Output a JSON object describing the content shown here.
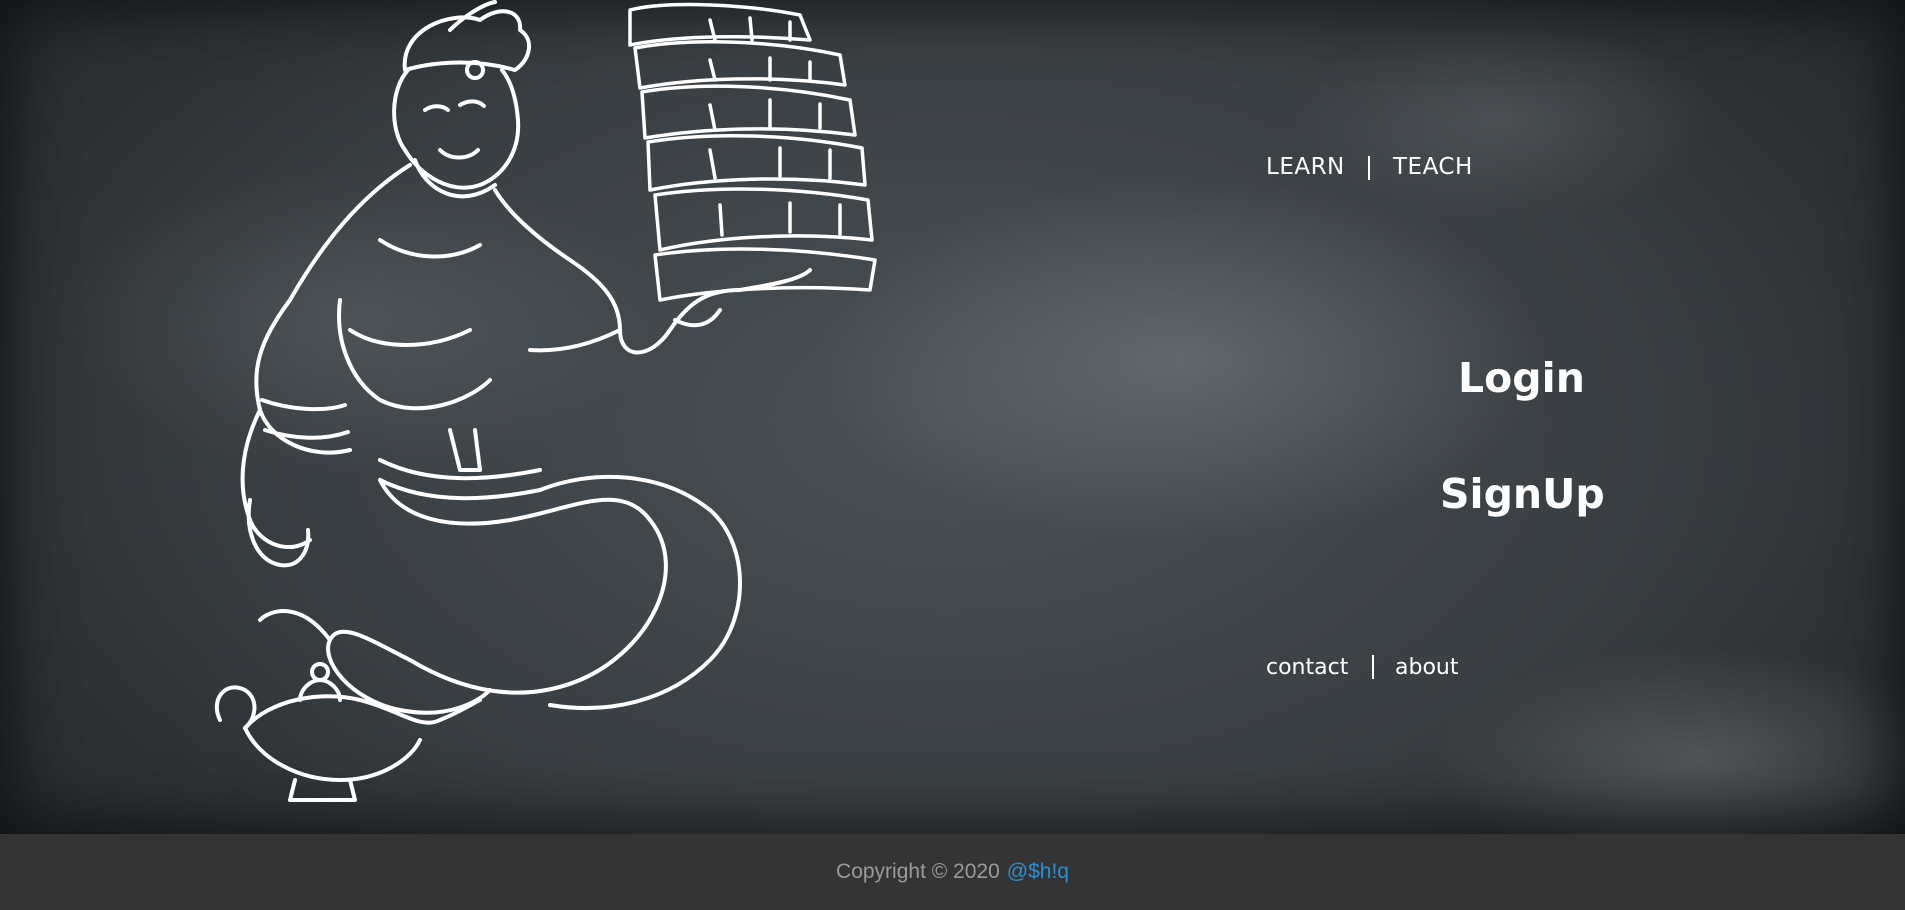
{
  "nav_top": {
    "learn_label": "LEARN",
    "teach_label": "TEACH"
  },
  "auth": {
    "login_label": "Login",
    "signup_label": "SignUp"
  },
  "nav_bottom": {
    "contact_label": "contact",
    "about_label": "about"
  },
  "footer": {
    "copyright_text": "Copyright © 2020",
    "handle_text": "@$h!q"
  },
  "illustration": {
    "icon": "genie-with-books-icon"
  },
  "colors": {
    "chalkboard": "#3a3f43",
    "chalk": "#ffffff",
    "footer_bg": "#343434",
    "footer_text": "#9a9a9a",
    "handle_link": "#2b8fd6"
  }
}
